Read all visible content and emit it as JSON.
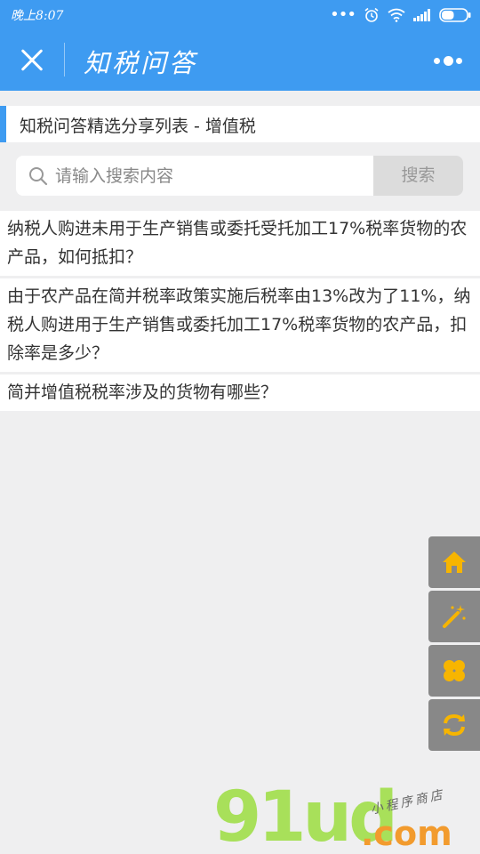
{
  "status_bar": {
    "time": "晚上8:07",
    "battery_level": 0.5
  },
  "title_bar": {
    "title": "知税问答"
  },
  "header": {
    "title": "知税问答精选分享列表 - 增值税"
  },
  "search": {
    "placeholder": "请输入搜索内容",
    "value": "",
    "button_label": "搜索"
  },
  "questions": [
    "纳税人购进未用于生产销售或委托受托加工17%税率货物的农产品，如何抵扣？",
    "由于农产品在简并税率政策实施后税率由13%改为了11%，纳税人购进用于生产销售或委托加工17%税率货物的农产品，扣除率是多少？",
    "简并增值税税率涉及的货物有哪些？"
  ],
  "float_menu": {
    "icons": [
      "home-icon",
      "magic-wand-icon",
      "clover-icon",
      "refresh-icon"
    ],
    "icon_color": "#f7b500",
    "bg_color": "#888888"
  },
  "watermark": {
    "big": "91ud",
    "com": ".com",
    "small": "小程序商店"
  },
  "colors": {
    "accent": "#3e9bf1",
    "background": "#efeff0"
  }
}
